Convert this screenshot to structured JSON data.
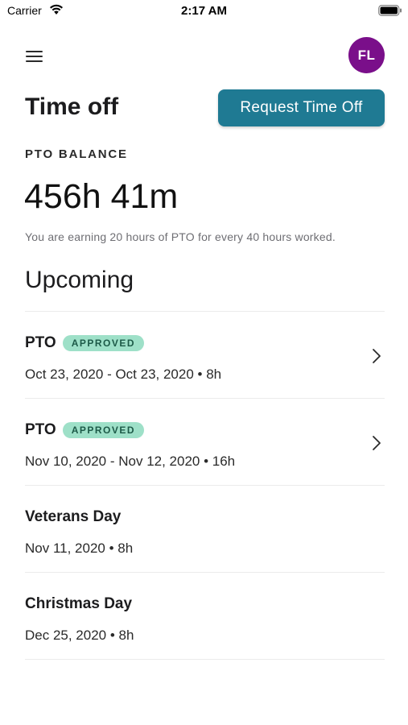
{
  "status_bar": {
    "carrier": "Carrier",
    "time": "2:17 AM"
  },
  "header": {
    "menu_icon": "menu-icon",
    "avatar_initials": "FL",
    "avatar_color": "#7a0f8a"
  },
  "page": {
    "title": "Time off",
    "request_button_label": "Request Time Off",
    "accent_color": "#1f7a93"
  },
  "balance": {
    "label": "PTO BALANCE",
    "value": "456h 41m",
    "note": "You are earning 20 hours of PTO for every 40 hours worked."
  },
  "upcoming": {
    "title": "Upcoming",
    "items": [
      {
        "title": "PTO",
        "badge": "APPROVED",
        "subtitle": "Oct 23, 2020 - Oct 23, 2020 • 8h",
        "chevron": true
      },
      {
        "title": "PTO",
        "badge": "APPROVED",
        "subtitle": "Nov 10, 2020 - Nov 12, 2020 • 16h",
        "chevron": true
      },
      {
        "title": "Veterans Day",
        "badge": "",
        "subtitle": "Nov 11, 2020 • 8h",
        "chevron": false
      },
      {
        "title": "Christmas Day",
        "badge": "",
        "subtitle": "Dec 25, 2020 • 8h",
        "chevron": false
      }
    ]
  }
}
